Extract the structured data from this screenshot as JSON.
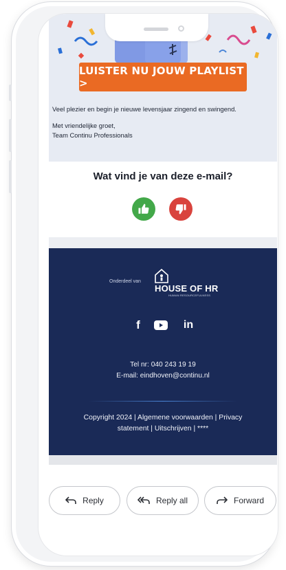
{
  "email": {
    "cta_label": "LUISTER NU JOUW PLAYLIST >",
    "body_line": "Veel plezier en begin je nieuwe levensjaar zingend en swingend.",
    "closing": "Met vriendelijke groet,",
    "signature": "Team Continu Professionals"
  },
  "feedback": {
    "question": "Wat vind je van deze e-mail?",
    "like_icon": "thumbs-up-icon",
    "dislike_icon": "thumbs-down-icon",
    "like_color": "#43a849",
    "dislike_color": "#d9433d"
  },
  "footer": {
    "part_of": "Onderdeel van",
    "brand_name": "HOUSE OF HR",
    "brand_tagline": "HUMAN RESOURCEFULNESS",
    "social": [
      "facebook-icon",
      "youtube-icon",
      "linkedin-icon"
    ],
    "facebook_glyph": "f",
    "linkedin_glyph": "in",
    "phone": "Tel nr: 040 243 19 19",
    "email": "E-mail: eindhoven@continu.nl",
    "copyright_line1": "Copyright 2024 |  Algemene voorwaarden  |  Privacy",
    "copyright_line2": "statement  |  Uitschrijven | ****",
    "background": "#1a2a57"
  },
  "actions": {
    "reply": "Reply",
    "reply_all": "Reply all",
    "forward": "Forward"
  },
  "theme": {
    "cta_color": "#ea6a23"
  }
}
